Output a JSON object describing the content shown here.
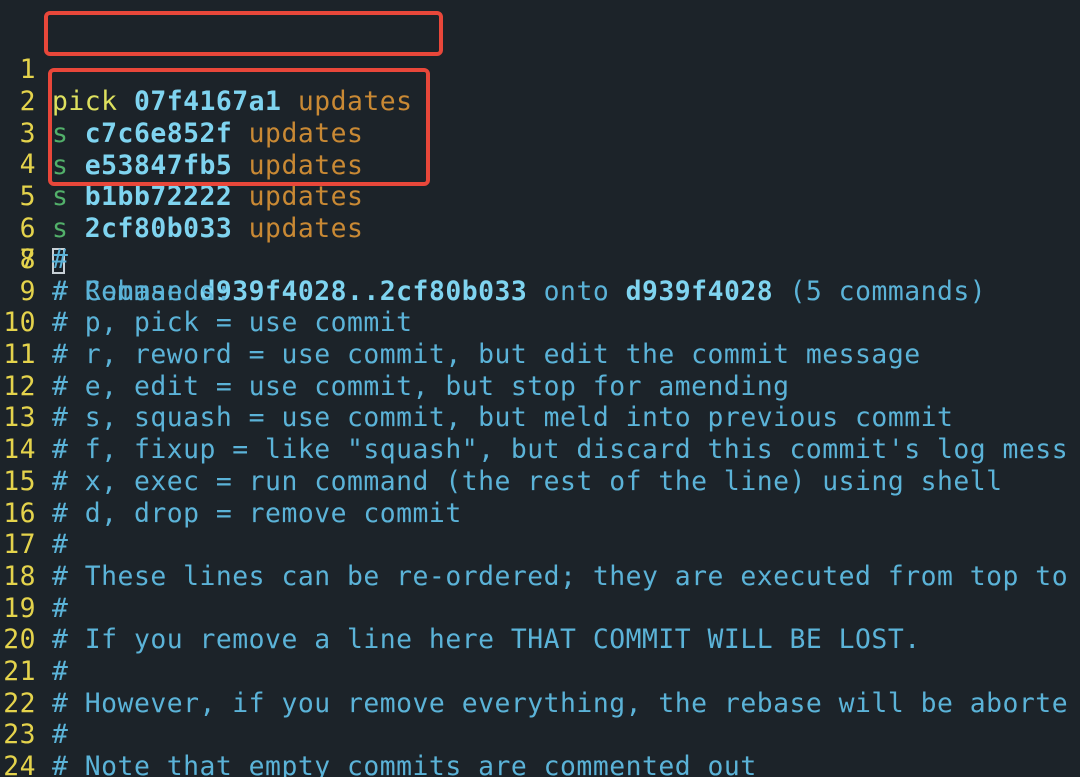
{
  "todo": [
    {
      "n": "1",
      "cmd": "pick",
      "hash": "07f4167a1",
      "msg": "updates"
    },
    {
      "n": "2",
      "cmd": "s",
      "hash": "c7c6e852f",
      "msg": "updates"
    },
    {
      "n": "3",
      "cmd": "s",
      "hash": "e53847fb5",
      "msg": "updates"
    },
    {
      "n": "4",
      "cmd": "s",
      "hash": "b1bb72222",
      "msg": "updates"
    },
    {
      "n": "5",
      "cmd": "s",
      "hash": "2cf80b033",
      "msg": "updates"
    }
  ],
  "line6": {
    "n": "6"
  },
  "rebase": {
    "n": "7",
    "prefix": "# Rebase ",
    "range": "d939f4028..2cf80b033",
    "onto_word": " onto ",
    "onto": "d939f4028",
    "suffix": " (5 commands)"
  },
  "comments": [
    {
      "n": "8",
      "text": "#"
    },
    {
      "n": "9",
      "text": "# Commands:"
    },
    {
      "n": "10",
      "text": "# p, pick = use commit"
    },
    {
      "n": "11",
      "text": "# r, reword = use commit, but edit the commit message"
    },
    {
      "n": "12",
      "text": "# e, edit = use commit, but stop for amending"
    },
    {
      "n": "13",
      "text": "# s, squash = use commit, but meld into previous commit"
    },
    {
      "n": "14",
      "text": "# f, fixup = like \"squash\", but discard this commit's log mess"
    },
    {
      "n": "15",
      "text": "# x, exec = run command (the rest of the line) using shell"
    },
    {
      "n": "16",
      "text": "# d, drop = remove commit"
    },
    {
      "n": "17",
      "text": "#"
    },
    {
      "n": "18",
      "text": "# These lines can be re-ordered; they are executed from top to"
    },
    {
      "n": "19",
      "text": "#"
    },
    {
      "n": "20",
      "text": "# If you remove a line here THAT COMMIT WILL BE LOST."
    },
    {
      "n": "21",
      "text": "#"
    },
    {
      "n": "22",
      "text": "# However, if you remove everything, the rebase will be aborte"
    },
    {
      "n": "23",
      "text": "#"
    },
    {
      "n": "24",
      "text": "# Note that empty commits are commented out"
    }
  ],
  "colors": {
    "background": "#1c2329",
    "line_number": "#e4d34c",
    "pick": "#dde05e",
    "squash": "#52b06a",
    "hash": "#7fd4f0",
    "message": "#c98934",
    "comment": "#5bb3d8",
    "highlight_box": "#e8473a"
  }
}
